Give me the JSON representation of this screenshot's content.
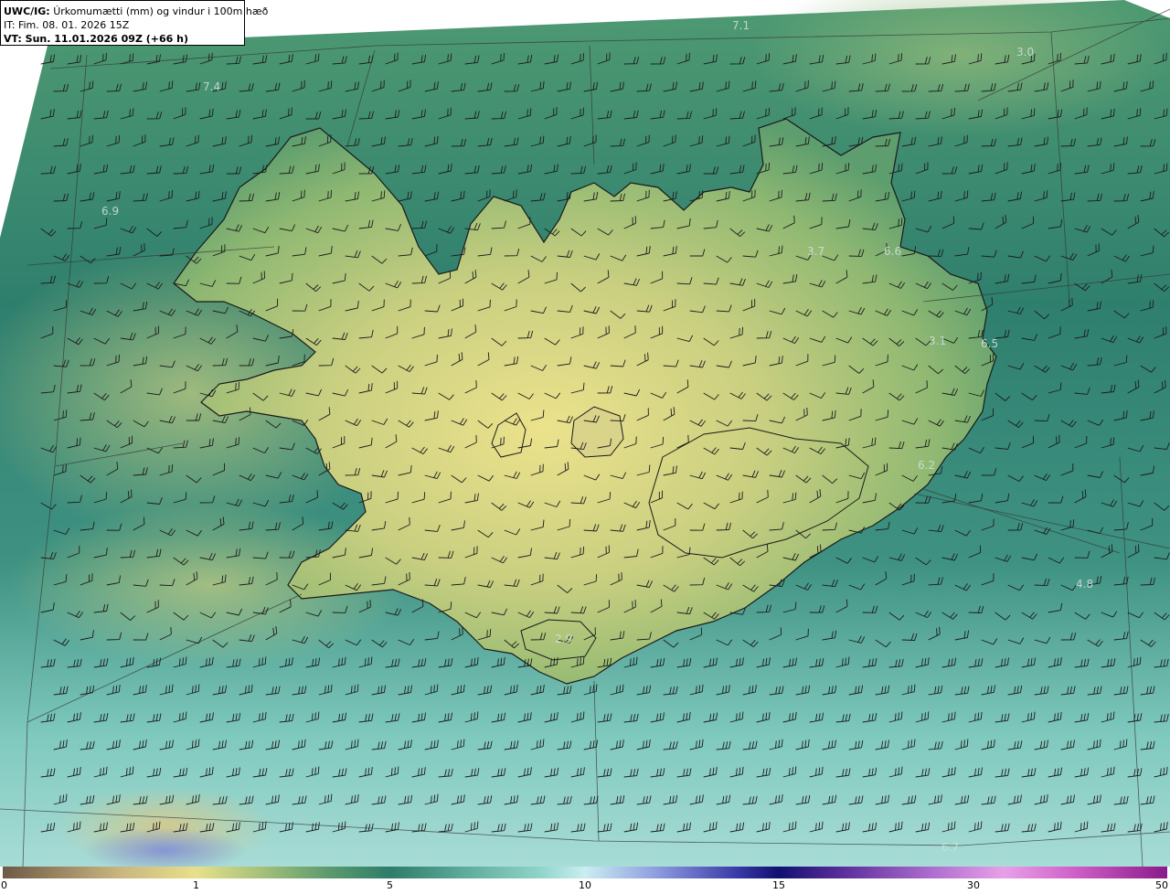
{
  "header": {
    "model_label": "UWC/IG:",
    "title": "Úrkomumætti (mm) og vindur i 100m hæð",
    "issue_time": "IT: Fim. 08. 01. 2026 15Z",
    "valid_time": "VT: Sun. 11.01.2026 09Z (+66 h)"
  },
  "colorbar": {
    "ticks": [
      "0",
      "1",
      "5",
      "10",
      "15",
      "30",
      "50"
    ]
  },
  "map_values": [
    "7.1",
    "3.0",
    "7.4",
    "6.9",
    "3.7",
    "6.6",
    "3.1",
    "6.5",
    "6.2",
    "4.8",
    "2.9",
    "6.7"
  ],
  "colors": {
    "ocean_dark": "#2f7f6e",
    "ocean_mid": "#3f8f78",
    "ocean_light": "#9fd6cf",
    "land_yellow": "#e6e08a",
    "land_green": "#8fb872",
    "coast": "#1a1a1a"
  }
}
